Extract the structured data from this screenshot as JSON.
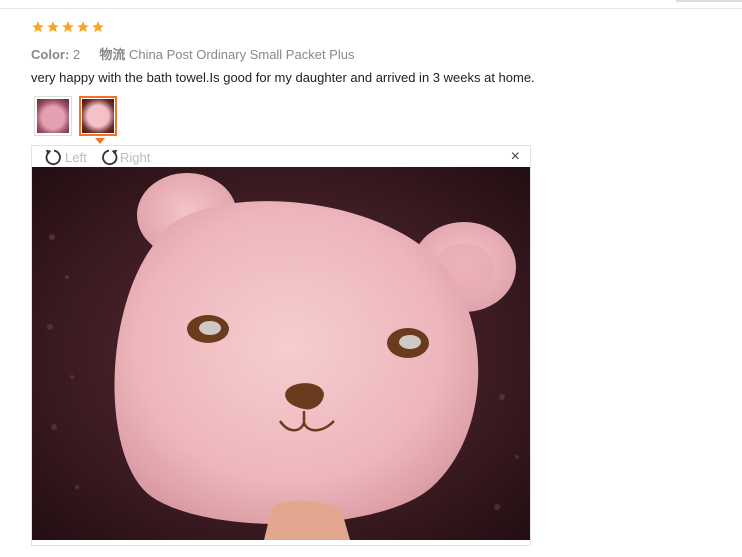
{
  "review": {
    "rating": 5,
    "rating_max": 5,
    "star_color": "#f5a623",
    "color_label": "Color:",
    "color_value": "2",
    "shipping_label": "物流",
    "shipping_value": "China Post Ordinary Small Packet Plus",
    "text": "very happy with the bath towel.Is good for my daughter and arrived in 3 weeks at home."
  },
  "thumbnails": [
    {
      "name": "thumbnail-1",
      "selected": false
    },
    {
      "name": "thumbnail-2",
      "selected": true
    }
  ],
  "viewer": {
    "rotate_left_label": "Left",
    "rotate_right_label": "Right",
    "close_symbol": "×",
    "accent_color": "#f57224"
  }
}
